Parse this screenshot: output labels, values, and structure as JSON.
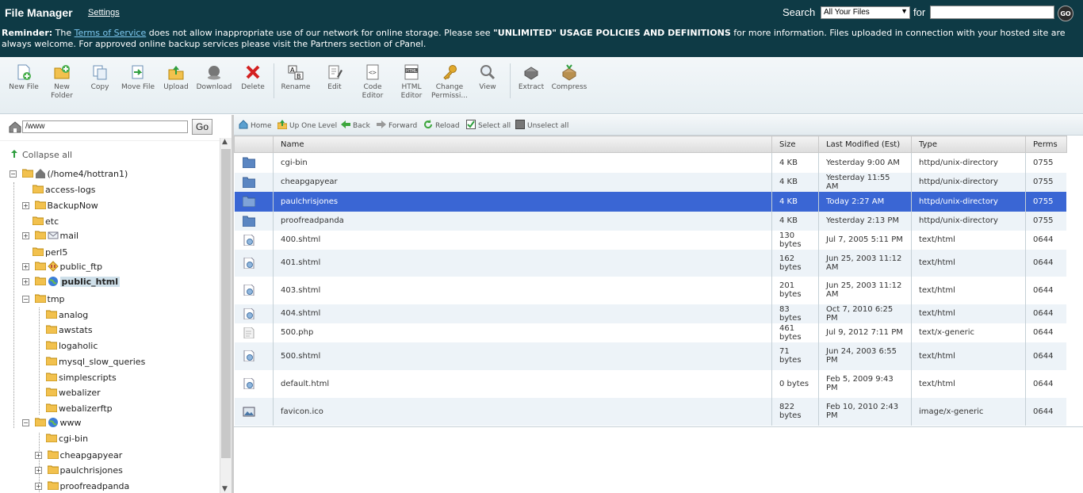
{
  "header": {
    "title": "File Manager",
    "settings_link": "Settings",
    "search_label": "Search",
    "search_scope": "All Your Files",
    "for_label": "for",
    "search_value": "",
    "go_label": "GO"
  },
  "reminder": {
    "label": "Reminder:",
    "text1": " The ",
    "tos_link": "Terms of Service",
    "text2": " does not allow inappropriate use of our network for online storage. Please see ",
    "policy": "\"UNLIMITED\" USAGE POLICIES AND DEFINITIONS",
    "text3": " for more information. Files uploaded in connection with your hosted site are always welcome. For approved online backup services please visit the Partners section of cPanel."
  },
  "toolbar": {
    "new_file": "New File",
    "new_folder": "New Folder",
    "copy": "Copy",
    "move_file": "Move File",
    "upload": "Upload",
    "download": "Download",
    "delete": "Delete",
    "rename": "Rename",
    "edit": "Edit",
    "code_editor": "Code Editor",
    "html_editor": "HTML Editor",
    "change_permissions": "Change Permissi...",
    "view": "View",
    "extract": "Extract",
    "compress": "Compress"
  },
  "path_bar": {
    "value": "www",
    "go": "Go"
  },
  "tree": {
    "collapse_all": "Collapse all",
    "root": "(/home4/hottran1)",
    "nodes": {
      "access_logs": "access-logs",
      "backupnow": "BackupNow",
      "etc": "etc",
      "mail": "mail",
      "perl5": "perl5",
      "public_ftp": "public_ftp",
      "public_html": "public_html",
      "tmp": "tmp",
      "analog": "analog",
      "awstats": "awstats",
      "logaholic": "logaholic",
      "mysql_slow_queries": "mysql_slow_queries",
      "simplescripts": "simplescripts",
      "webalizer": "webalizer",
      "webalizerftp": "webalizerftp",
      "www": "www",
      "www_cgi_bin": "cgi-bin",
      "www_cheapgapyear": "cheapgapyear",
      "www_paulchrisjones": "paulchrisjones",
      "www_proofreadpanda": "proofreadpanda"
    }
  },
  "nav": {
    "home": "Home",
    "up_one_level": "Up One Level",
    "back": "Back",
    "forward": "Forward",
    "reload": "Reload",
    "select_all": "Select all",
    "unselect_all": "Unselect all"
  },
  "table": {
    "headers": {
      "name": "Name",
      "size": "Size",
      "modified": "Last Modified (Est)",
      "type": "Type",
      "perms": "Perms"
    },
    "rows": [
      {
        "name": "cgi-bin",
        "size": "4 KB",
        "modified": "Yesterday 9:00 AM",
        "type": "httpd/unix-directory",
        "perms": "0755"
      },
      {
        "name": "cheapgapyear",
        "size": "4 KB",
        "modified": "Yesterday 11:55 AM",
        "type": "httpd/unix-directory",
        "perms": "0755"
      },
      {
        "name": "paulchrisjones",
        "size": "4 KB",
        "modified": "Today 2:27 AM",
        "type": "httpd/unix-directory",
        "perms": "0755"
      },
      {
        "name": "proofreadpanda",
        "size": "4 KB",
        "modified": "Yesterday 2:13 PM",
        "type": "httpd/unix-directory",
        "perms": "0755"
      },
      {
        "name": "400.shtml",
        "size": "130 bytes",
        "modified": "Jul 7, 2005 5:11 PM",
        "type": "text/html",
        "perms": "0644"
      },
      {
        "name": "401.shtml",
        "size": "162 bytes",
        "modified": "Jun 25, 2003 11:12 AM",
        "type": "text/html",
        "perms": "0644"
      },
      {
        "name": "403.shtml",
        "size": "201 bytes",
        "modified": "Jun 25, 2003 11:12 AM",
        "type": "text/html",
        "perms": "0644"
      },
      {
        "name": "404.shtml",
        "size": "83 bytes",
        "modified": "Oct 7, 2010 6:25 PM",
        "type": "text/html",
        "perms": "0644"
      },
      {
        "name": "500.php",
        "size": "461 bytes",
        "modified": "Jul 9, 2012 7:11 PM",
        "type": "text/x-generic",
        "perms": "0644"
      },
      {
        "name": "500.shtml",
        "size": "71 bytes",
        "modified": "Jun 24, 2003 6:55 PM",
        "type": "text/html",
        "perms": "0644"
      },
      {
        "name": "default.html",
        "size": "0 bytes",
        "modified": "Feb 5, 2009 9:43 PM",
        "type": "text/html",
        "perms": "0644"
      },
      {
        "name": "favicon.ico",
        "size": "822 bytes",
        "modified": "Feb 10, 2010 2:43 PM",
        "type": "image/x-generic",
        "perms": "0644"
      }
    ]
  },
  "colors": {
    "header_bg": "#0e3a45",
    "selected_row": "#3a66d4",
    "alt_row": "#edf3f8",
    "folder_icon": "#5b86c2",
    "tree_folder": "#f2c14e"
  }
}
